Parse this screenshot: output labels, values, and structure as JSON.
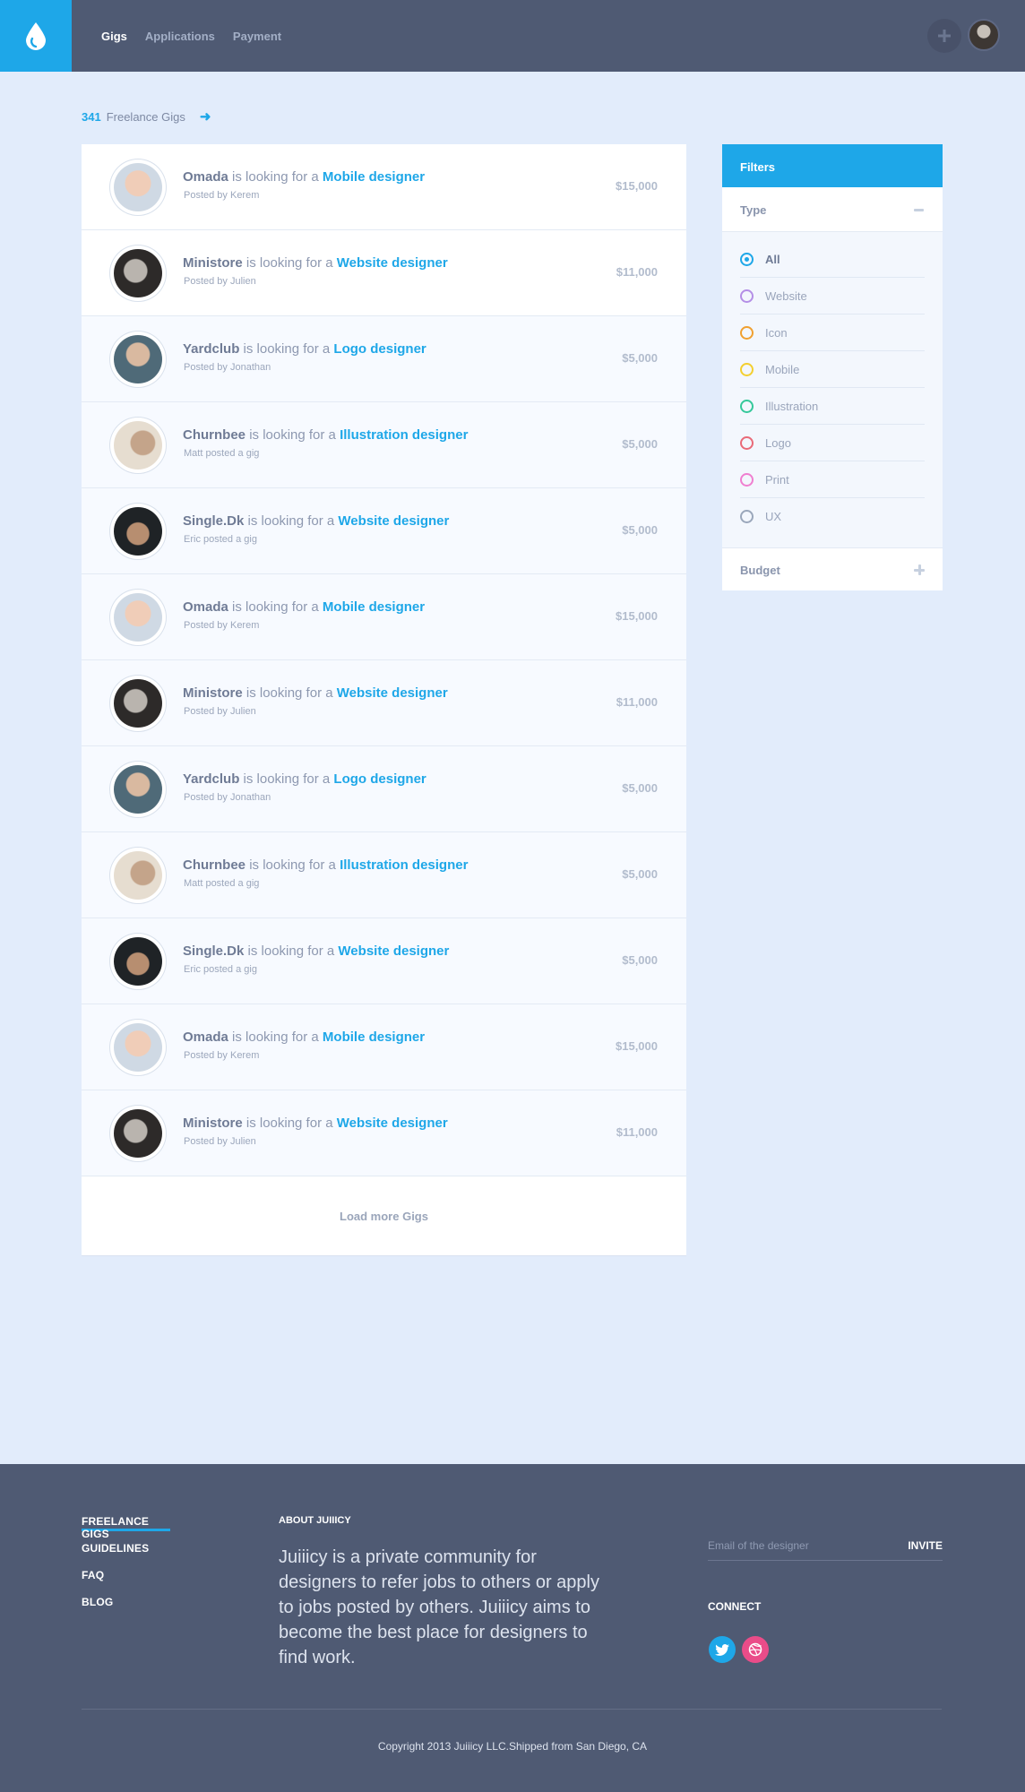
{
  "header": {
    "nav": [
      {
        "label": "Gigs",
        "active": true
      },
      {
        "label": "Applications",
        "active": false
      },
      {
        "label": "Payment",
        "active": false
      }
    ]
  },
  "summary": {
    "count": "341",
    "label": "Freelance Gigs"
  },
  "gigs": [
    {
      "company": "Omada",
      "connector": "is looking for a",
      "role": "Mobile designer",
      "posted": "Posted by Kerem",
      "price": "$15,000"
    },
    {
      "company": "Ministore",
      "connector": "is looking for a",
      "role": "Website designer",
      "posted": "Posted by Julien",
      "price": "$11,000"
    },
    {
      "company": "Yardclub",
      "connector": "is looking for a",
      "role": "Logo designer",
      "posted": "Posted by Jonathan",
      "price": "$5,000"
    },
    {
      "company": "Churnbee",
      "connector": "is looking for a",
      "role": "Illustration designer",
      "posted": "Matt posted a gig",
      "price": "$5,000"
    },
    {
      "company": "Single.Dk",
      "connector": "is looking for a",
      "role": "Website designer",
      "posted": "Eric posted a gig",
      "price": "$5,000"
    },
    {
      "company": "Omada",
      "connector": "is looking for a",
      "role": "Mobile designer",
      "posted": "Posted by Kerem",
      "price": "$15,000"
    },
    {
      "company": "Ministore",
      "connector": "is looking for a",
      "role": "Website designer",
      "posted": "Posted by Julien",
      "price": "$11,000"
    },
    {
      "company": "Yardclub",
      "connector": "is looking for a",
      "role": "Logo designer",
      "posted": "Posted by Jonathan",
      "price": "$5,000"
    },
    {
      "company": "Churnbee",
      "connector": "is looking for a",
      "role": "Illustration designer",
      "posted": "Matt posted a gig",
      "price": "$5,000"
    },
    {
      "company": "Single.Dk",
      "connector": "is looking for a",
      "role": "Website designer",
      "posted": "Eric posted a gig",
      "price": "$5,000"
    },
    {
      "company": "Omada",
      "connector": "is looking for a",
      "role": "Mobile designer",
      "posted": "Posted by Kerem",
      "price": "$15,000"
    },
    {
      "company": "Ministore",
      "connector": "is looking for a",
      "role": "Website designer",
      "posted": "Posted by Julien",
      "price": "$11,000"
    }
  ],
  "load_more": "Load more Gigs",
  "filters": {
    "title": "Filters",
    "type_label": "Type",
    "budget_label": "Budget",
    "options": [
      {
        "label": "All",
        "color": "#1ea7e8",
        "selected": true
      },
      {
        "label": "Website",
        "color": "#b48fe6",
        "selected": false
      },
      {
        "label": "Icon",
        "color": "#f0a030",
        "selected": false
      },
      {
        "label": "Mobile",
        "color": "#f3cf2f",
        "selected": false
      },
      {
        "label": "Illustration",
        "color": "#35c89a",
        "selected": false
      },
      {
        "label": "Logo",
        "color": "#e96a78",
        "selected": false
      },
      {
        "label": "Print",
        "color": "#ef7fd0",
        "selected": false
      },
      {
        "label": "UX",
        "color": "#9aa7bb",
        "selected": false
      }
    ]
  },
  "footer": {
    "nav": [
      "FREELANCE GIGS",
      "GUIDELINES",
      "FAQ",
      "BLOG"
    ],
    "about_heading": "ABOUT JUIIICY",
    "about_text": "Juiiicy is a private community for designers to refer jobs to others or apply to jobs posted by others. Juiiicy aims to become the best place for designers to find work.",
    "email_placeholder": "Email of the designer",
    "invite_label": "INVITE",
    "connect_label": "CONNECT",
    "copyright": "Copyright 2013 Juiiicy LLC.Shipped from San Diego, CA"
  },
  "colors": {
    "accent": "#1ea7e8",
    "header_bg": "#4f5a73",
    "page_bg": "#e2ecfb",
    "dribbble": "#ea4c89"
  }
}
